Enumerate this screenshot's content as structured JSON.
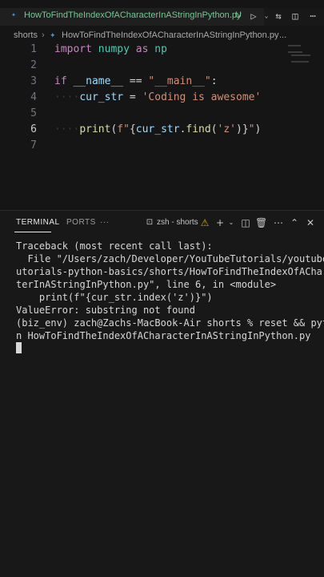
{
  "tab": {
    "file_name": "HowToFindTheIndexOfACharacterInAStringInPython.py",
    "status": "U",
    "icon": "python-file-icon"
  },
  "toolbar": {
    "icons": [
      "run-icon",
      "run-dropdown-icon",
      "compare-changes-icon",
      "split-editor-icon",
      "more-actions-icon"
    ]
  },
  "breadcrumb": {
    "folder": "shorts",
    "file": "HowToFindTheIndexOfACharacterInAStringInPython.py",
    "more": "..."
  },
  "editor": {
    "active_line": 6,
    "lines": [
      {
        "num": "1",
        "tokens": [
          [
            "kw",
            "import"
          ],
          [
            "op",
            " "
          ],
          [
            "mod",
            "numpy"
          ],
          [
            "op",
            " "
          ],
          [
            "kw",
            "as"
          ],
          [
            "op",
            " "
          ],
          [
            "mod",
            "np"
          ]
        ]
      },
      {
        "num": "2",
        "tokens": []
      },
      {
        "num": "3",
        "tokens": [
          [
            "kw",
            "if"
          ],
          [
            "op",
            " "
          ],
          [
            "var",
            "__name__"
          ],
          [
            "op",
            " == "
          ],
          [
            "str",
            "\"__main__\""
          ],
          [
            "op",
            ":"
          ]
        ]
      },
      {
        "num": "4",
        "tokens": [
          [
            "dots",
            "····"
          ],
          [
            "var",
            "cur_str"
          ],
          [
            "op",
            " = "
          ],
          [
            "str",
            "'Coding is awesome'"
          ]
        ]
      },
      {
        "num": "5",
        "tokens": []
      },
      {
        "num": "6",
        "tokens": [
          [
            "dots",
            "····"
          ],
          [
            "fn",
            "print"
          ],
          [
            "op",
            "("
          ],
          [
            "str",
            "f\""
          ],
          [
            "op",
            "{"
          ],
          [
            "var",
            "cur_str"
          ],
          [
            "op",
            "."
          ],
          [
            "fn",
            "find"
          ],
          [
            "op",
            "("
          ],
          [
            "str",
            "'z'"
          ],
          [
            "op",
            ")}"
          ],
          [
            "str",
            "\""
          ],
          [
            "op",
            ")"
          ]
        ]
      },
      {
        "num": "7",
        "tokens": []
      }
    ]
  },
  "panel": {
    "tabs": [
      "TERMINAL",
      "PORTS"
    ],
    "more_label": "···",
    "terminal_name": "zsh - shorts",
    "icons": [
      "terminal-icon",
      "warning-icon",
      "new-terminal-icon",
      "dropdown-icon",
      "split-terminal-icon",
      "trash-icon",
      "more-icon",
      "maximize-icon",
      "close-icon"
    ]
  },
  "terminal": {
    "lines": [
      "Traceback (most recent call last):",
      "  File \"/Users/zach/Developer/YouTubeTutorials/youtube-t",
      "utorials-python-basics/shorts/HowToFindTheIndexOfACharac",
      "terInAStringInPython.py\", line 6, in <module>",
      "    print(f\"{cur_str.index('z')}\")",
      "ValueError: substring not found",
      "(biz_env) zach@Zachs-MacBook-Air shorts % reset && pytho",
      "n HowToFindTheIndexOfACharacterInAStringInPython.py"
    ]
  }
}
